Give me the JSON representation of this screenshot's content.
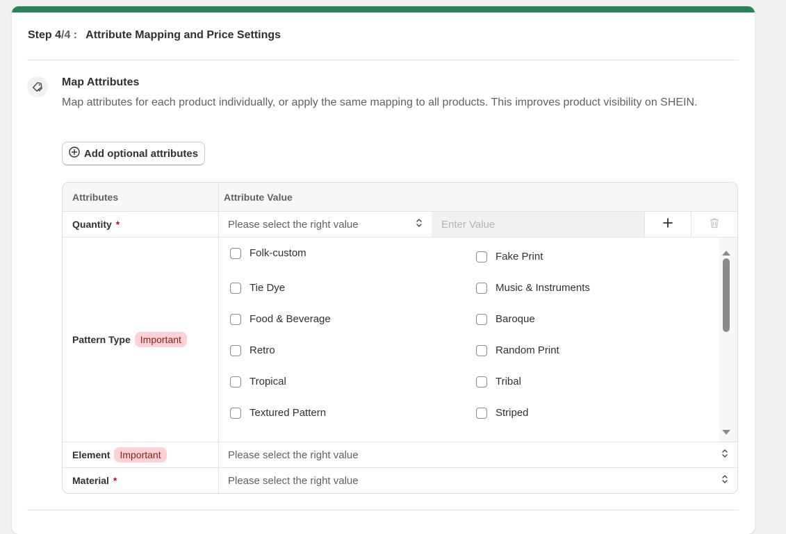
{
  "step": {
    "label": "Step 4",
    "total": "/4 :",
    "title": "Attribute Mapping and Price Settings"
  },
  "section": {
    "icon": "tag-icon",
    "title": "Map Attributes",
    "description": "Map attributes for each product individually, or apply the same mapping to all products. This improves product visibility on SHEIN."
  },
  "add_button": {
    "label": "Add optional attributes",
    "icon": "plus-circle-icon"
  },
  "table": {
    "headers": {
      "attributes": "Attributes",
      "value": "Attribute Value"
    },
    "quantity": {
      "label": "Quantity",
      "required_mark": "*",
      "select_placeholder": "Please select the right value",
      "input_placeholder": "Enter Value",
      "add_icon": "plus-icon",
      "delete_icon": "trash-icon"
    },
    "pattern": {
      "label": "Pattern Type",
      "badge": "Important",
      "options_left": [
        "Folk-custom",
        "Tie Dye",
        "Food & Beverage",
        "Retro",
        "Tropical",
        "Textured Pattern"
      ],
      "options_right": [
        "Fake Print",
        "Music & Instruments",
        "Baroque",
        "Random Print",
        "Tribal",
        "Striped"
      ]
    },
    "element": {
      "label": "Element",
      "badge": "Important",
      "select_placeholder": "Please select the right value"
    },
    "material": {
      "label": "Material",
      "required_mark": "*",
      "select_placeholder": "Please select the right value"
    }
  },
  "colors": {
    "accent": "#29845a",
    "badge_bg": "#fed1d7",
    "badge_text": "#8e1f0b",
    "required": "#c70a24"
  }
}
